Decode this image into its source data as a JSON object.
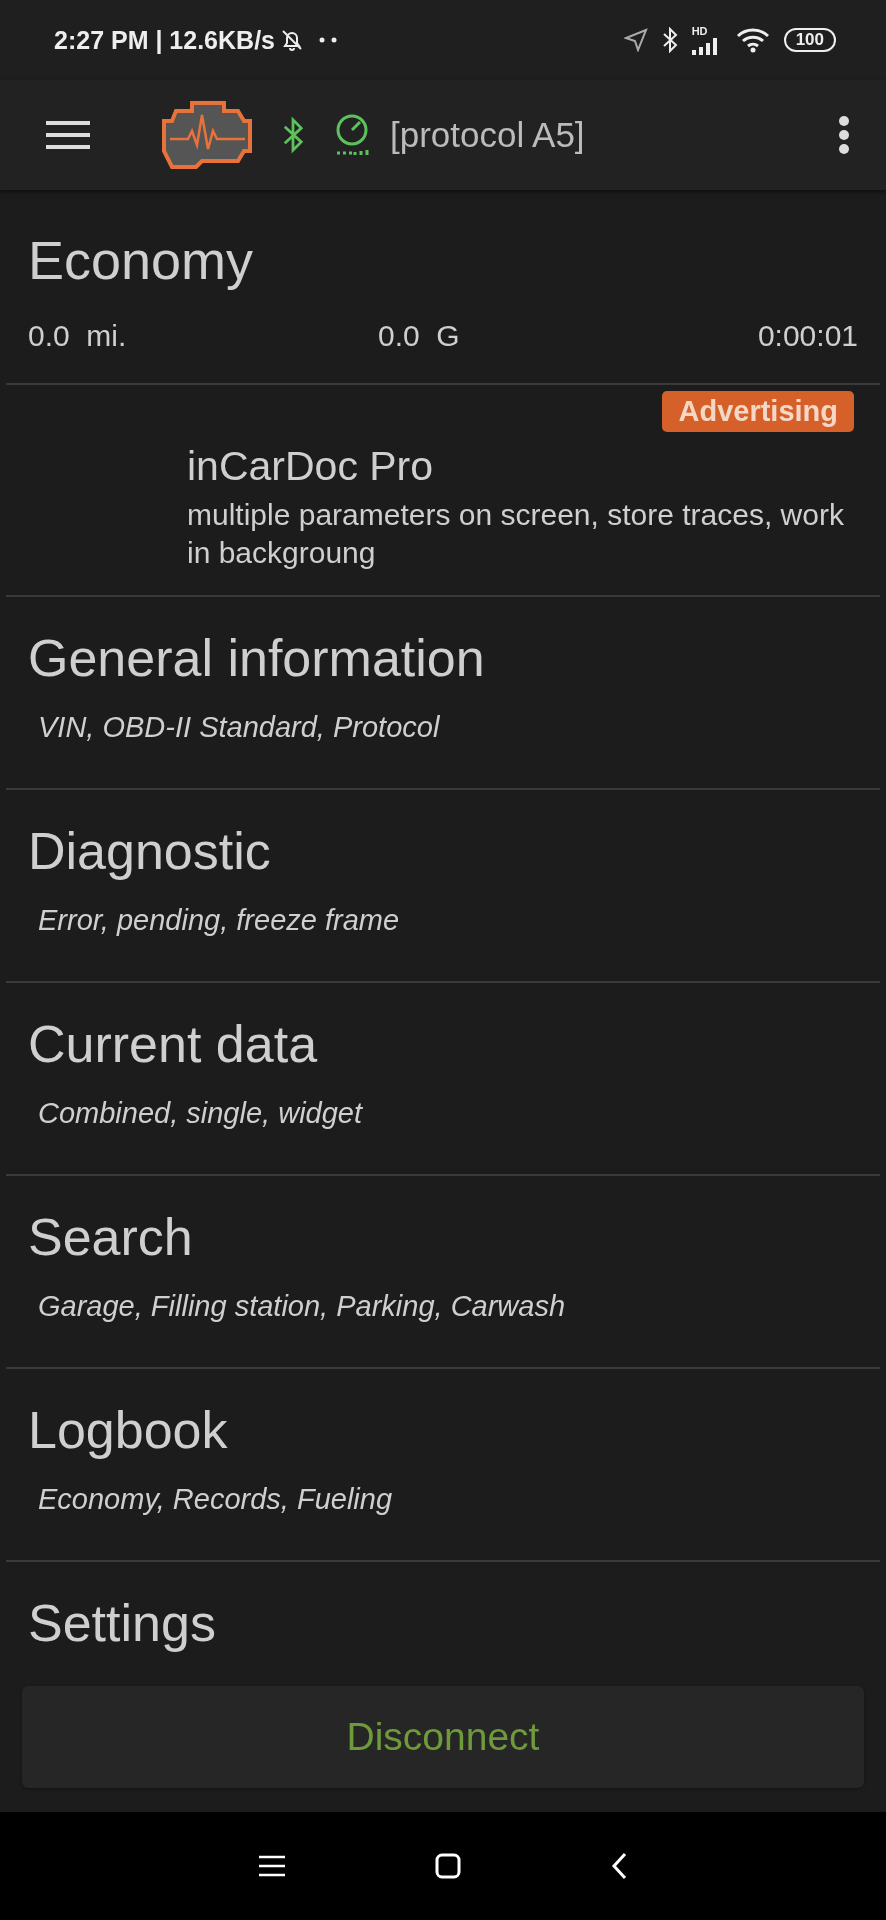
{
  "status_bar": {
    "time": "2:27 PM | 12.6KB/s",
    "network": "HD",
    "battery": "100"
  },
  "toolbar": {
    "title": "[protocol A5]"
  },
  "economy": {
    "title": "Economy",
    "stats": [
      {
        "value": "0.0",
        "unit": "mi."
      },
      {
        "value": "0.0",
        "unit": "G"
      },
      {
        "value": "0:00:01"
      }
    ]
  },
  "ad": {
    "badge": "Advertising",
    "title": "inCarDoc Pro",
    "text": "multiple parameters on screen, store traces, work in backgroung"
  },
  "menu": [
    {
      "title": "General information",
      "subtitle": "VIN, OBD-II Standard, Protocol"
    },
    {
      "title": "Diagnostic",
      "subtitle": "Error, pending, freeze frame"
    },
    {
      "title": "Current data",
      "subtitle": "Combined, single, widget"
    },
    {
      "title": "Search",
      "subtitle": "Garage, Filling station, Parking, Carwash"
    },
    {
      "title": "Logbook",
      "subtitle": "Economy, Records, Fueling"
    },
    {
      "title": "Settings"
    }
  ],
  "disconnect_button": "Disconnect"
}
